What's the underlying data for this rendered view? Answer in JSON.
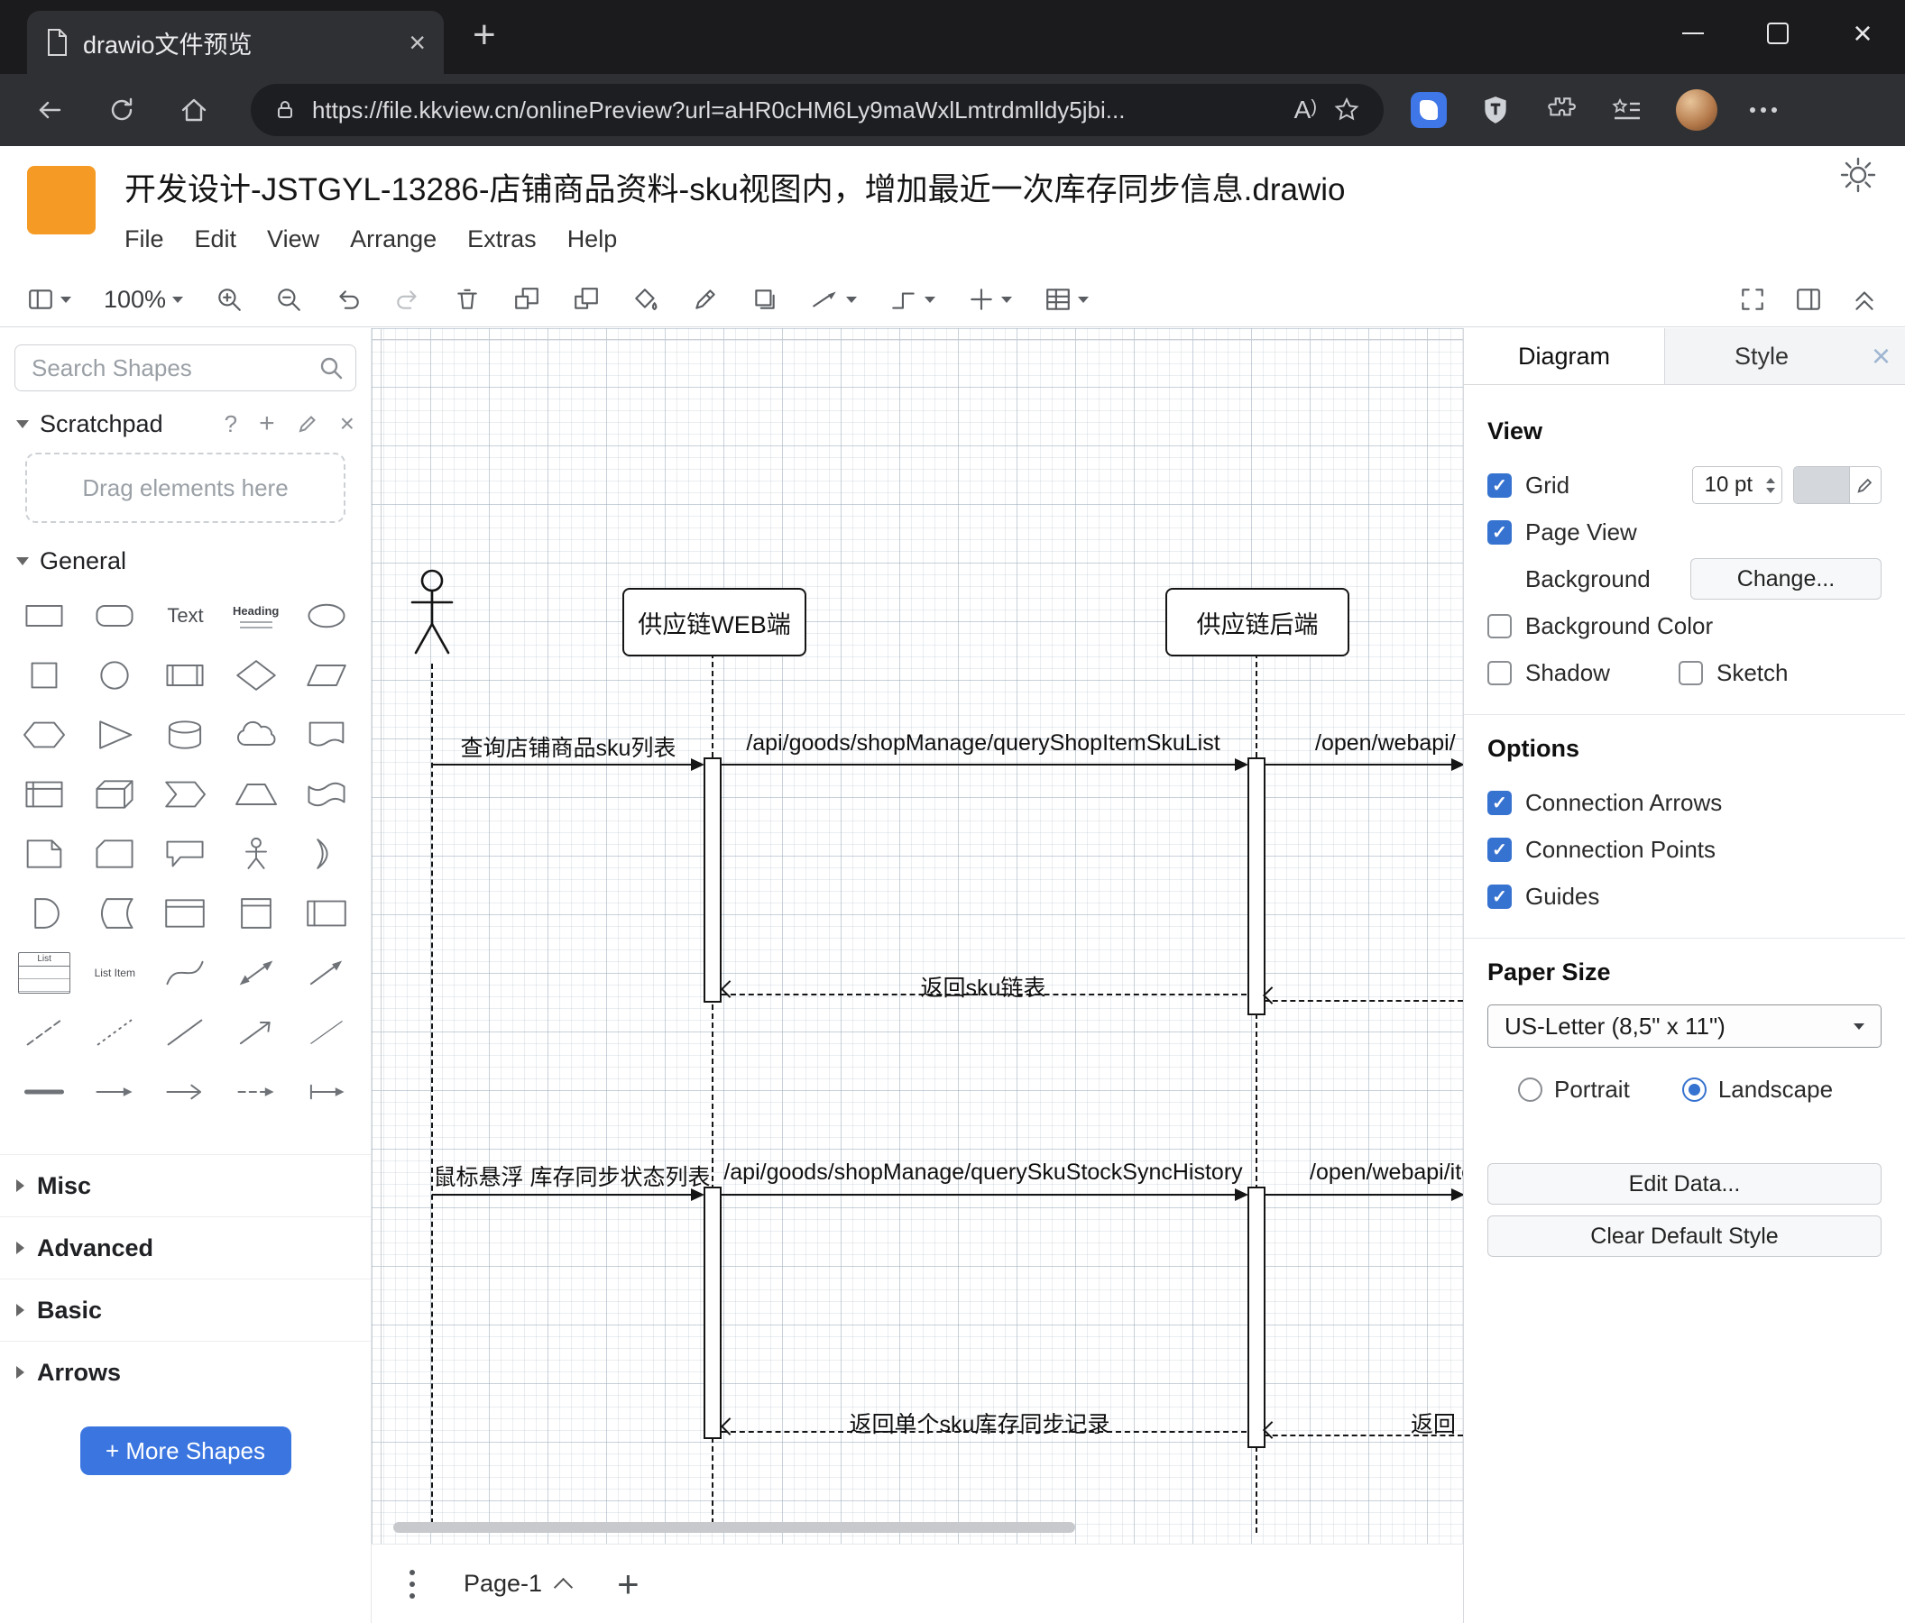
{
  "browser": {
    "tab": {
      "title": "drawio文件预览"
    },
    "url": "https://file.kkview.cn/onlinePreview?url=aHR0cHM6Ly9maWxlLmtrdmlldy5jbi...",
    "read_aloud": "A"
  },
  "app": {
    "title": "开发设计-JSTGYL-13286-店铺商品资料-sku视图内，增加最近一次库存同步信息.drawio",
    "menus": [
      "File",
      "Edit",
      "View",
      "Arrange",
      "Extras",
      "Help"
    ],
    "toolbar": {
      "zoom": "100%"
    }
  },
  "sidebar": {
    "search_placeholder": "Search Shapes",
    "scratchpad": "Scratchpad",
    "drag_hint": "Drag elements here",
    "sections": {
      "general": "General",
      "misc": "Misc",
      "advanced": "Advanced",
      "basic": "Basic",
      "arrows": "Arrows"
    },
    "shape_labels": {
      "text": "Text",
      "heading": "Heading",
      "list": "List",
      "list_item": "List Item"
    },
    "more_shapes": "+ More Shapes"
  },
  "diagram": {
    "lifelines": [
      "供应链WEB端",
      "供应链后端"
    ],
    "messages": {
      "query_sku_list": "查询店铺商品sku列表",
      "api_query_shop_item_sku_list": "/api/goods/shopManage/queryShopItemSkuList",
      "open_webapi_1": "/open/webapi/",
      "return_sku_list": "返回sku链表",
      "hover_stock_sync": "鼠标悬浮 库存同步状态列表",
      "api_query_sku_stock_sync_history": "/api/goods/shopManage/querySkuStockSyncHistory",
      "open_webapi_2": "/open/webapi/item",
      "return_single_sku": "返回单个sku库存同步记录",
      "return_partial": "返回"
    },
    "page_tab": "Page-1"
  },
  "panel": {
    "tabs": {
      "diagram": "Diagram",
      "style": "Style"
    },
    "view": {
      "heading": "View",
      "grid": "Grid",
      "grid_size": "10 pt",
      "page_view": "Page View",
      "background": "Background",
      "change_button": "Change...",
      "background_color": "Background Color",
      "shadow": "Shadow",
      "sketch": "Sketch"
    },
    "options": {
      "heading": "Options",
      "connection_arrows": "Connection Arrows",
      "connection_points": "Connection Points",
      "guides": "Guides"
    },
    "paper": {
      "heading": "Paper Size",
      "size_value": "US-Letter (8,5\" x 11\")",
      "portrait": "Portrait",
      "landscape": "Landscape"
    },
    "actions": {
      "edit_data": "Edit Data...",
      "clear_default_style": "Clear Default Style"
    }
  },
  "colors": {
    "logo_orange": "#f59b25",
    "primary_blue": "#3b76e0",
    "checkbox_blue": "#3672cf"
  }
}
